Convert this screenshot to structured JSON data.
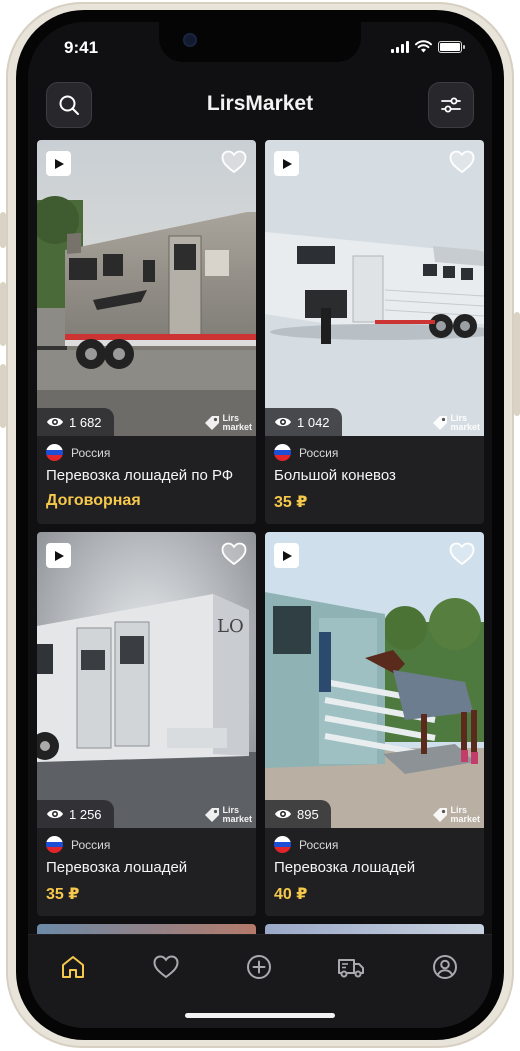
{
  "status": {
    "time": "9:41"
  },
  "header": {
    "title": "LirsMarket"
  },
  "brand": {
    "line1": "Lirs",
    "line2": "market"
  },
  "colors": {
    "accent": "#f6c84b",
    "background": "#101012",
    "card": "#202023"
  },
  "listings": [
    {
      "country": "Россия",
      "title": "Перевозка лошадей по РФ",
      "price": "Договорная",
      "views": "1 682",
      "has_video": true,
      "favorite": false
    },
    {
      "country": "Россия",
      "title": "Большой коневоз",
      "price": "35 ₽",
      "views": "1 042",
      "has_video": true,
      "favorite": false
    },
    {
      "country": "Россия",
      "title": "Перевозка лошадей",
      "price": "35 ₽",
      "views": "1 256",
      "has_video": true,
      "favorite": false
    },
    {
      "country": "Россия",
      "title": "Перевозка лошадей",
      "price": "40 ₽",
      "views": "895",
      "has_video": true,
      "favorite": false
    }
  ],
  "tabbar": {
    "active": "home",
    "items": [
      "home",
      "favorites",
      "add",
      "transport",
      "profile"
    ]
  }
}
